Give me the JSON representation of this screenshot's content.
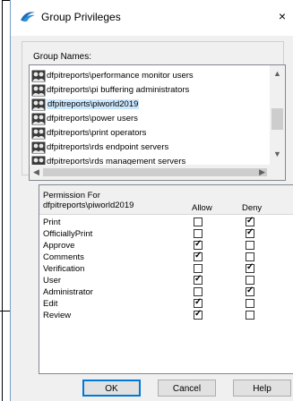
{
  "window": {
    "title": "Group Privileges",
    "close_glyph": "×"
  },
  "group_names": {
    "label": "Group Names:",
    "items": [
      {
        "label": "dfpitreports\\performance monitor users",
        "selected": false
      },
      {
        "label": "dfpitreports\\pi buffering administrators",
        "selected": false
      },
      {
        "label": "dfpitreports\\piworld2019",
        "selected": true
      },
      {
        "label": "dfpitreports\\power users",
        "selected": false
      },
      {
        "label": "dfpitreports\\print operators",
        "selected": false
      },
      {
        "label": "dfpitreports\\rds endpoint servers",
        "selected": false
      },
      {
        "label": "dfpitreports\\rds management servers",
        "selected": false
      }
    ],
    "icon": "group-users-icon"
  },
  "permissions": {
    "header": "Permission For dfpitreports\\piworld2019",
    "allow_label": "Allow",
    "deny_label": "Deny",
    "rows": [
      {
        "label": "Print",
        "allow": false,
        "deny": true
      },
      {
        "label": "OfficiallyPrint",
        "allow": false,
        "deny": true
      },
      {
        "label": "Approve",
        "allow": true,
        "deny": false
      },
      {
        "label": "Comments",
        "allow": true,
        "deny": false
      },
      {
        "label": "Verification",
        "allow": false,
        "deny": true
      },
      {
        "label": "User",
        "allow": true,
        "deny": false
      },
      {
        "label": "Administrator",
        "allow": false,
        "deny": true
      },
      {
        "label": "Edit",
        "allow": true,
        "deny": false
      },
      {
        "label": "Review",
        "allow": true,
        "deny": false
      }
    ]
  },
  "buttons": {
    "ok": "OK",
    "cancel": "Cancel",
    "help": "Help"
  },
  "colors": {
    "selection": "#cce8ff",
    "ok_border": "#0078d7"
  }
}
